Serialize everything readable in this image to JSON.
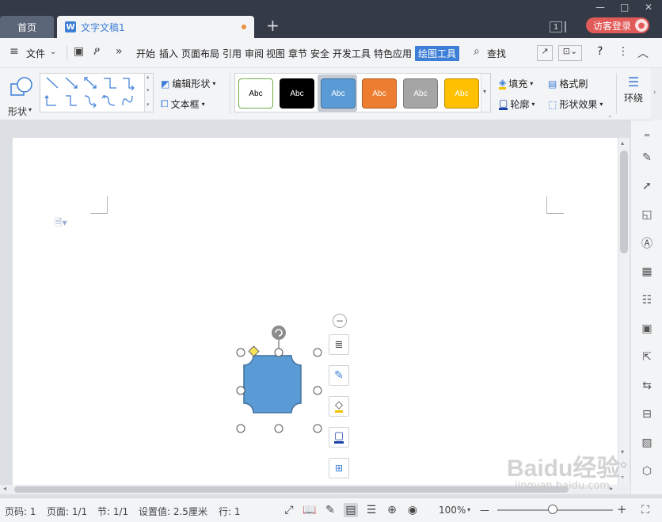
{
  "titlebar": {
    "home_tab": "首页",
    "doc_badge": "W",
    "doc_title": "文字文稿1",
    "new_tab": "+",
    "page_count": "1",
    "login_label": "访客登录",
    "minimize": "—",
    "maximize": "□",
    "close": "✕"
  },
  "menubar": {
    "file_label": "文件",
    "more": "»",
    "tabs": [
      "开始",
      "插入",
      "页面布局",
      "引用",
      "审阅",
      "视图",
      "章节",
      "安全",
      "开发工具",
      "特色应用",
      "绘图工具"
    ],
    "active_tab": "绘图工具",
    "search_label": "查找",
    "help": "?"
  },
  "ribbon": {
    "shape_label": "形状",
    "edit_shape": "编辑形状",
    "text_box": "文本框",
    "styles": [
      {
        "label": "Abc",
        "bg": "#ffffff",
        "border": "#70ad47",
        "fg": "#000000"
      },
      {
        "label": "Abc",
        "bg": "#000000",
        "border": "#000000",
        "fg": "#ffffff"
      },
      {
        "label": "Abc",
        "bg": "#5b9bd5",
        "border": "#41719c",
        "fg": "#ffffff"
      },
      {
        "label": "Abc",
        "bg": "#ed7d31",
        "border": "#ae5a21",
        "fg": "#ffffff"
      },
      {
        "label": "Abc",
        "bg": "#a5a5a5",
        "border": "#7c7c7c",
        "fg": "#ffffff"
      },
      {
        "label": "Abc",
        "bg": "#ffc000",
        "border": "#bc8c00",
        "fg": "#ffffff"
      }
    ],
    "fill": "填充",
    "outline": "轮廓",
    "format_painter": "格式刷",
    "shape_effects": "形状效果",
    "wrap": "环绕"
  },
  "canvas": {
    "shape_fill": "#5b9bd5",
    "shape_stroke": "#41719c",
    "adjust_handle_color": "#f4e25a"
  },
  "statusbar": {
    "page_no": "页码: 1",
    "pages": "页面: 1/1",
    "section": "节: 1/1",
    "setting": "设置值: 2.5厘米",
    "row": "行: 1",
    "zoom": "100%",
    "zoom_out": "—",
    "zoom_in": "+"
  },
  "watermark": {
    "main": "Baidu经验",
    "sub": "jingyan.baidu.com"
  }
}
